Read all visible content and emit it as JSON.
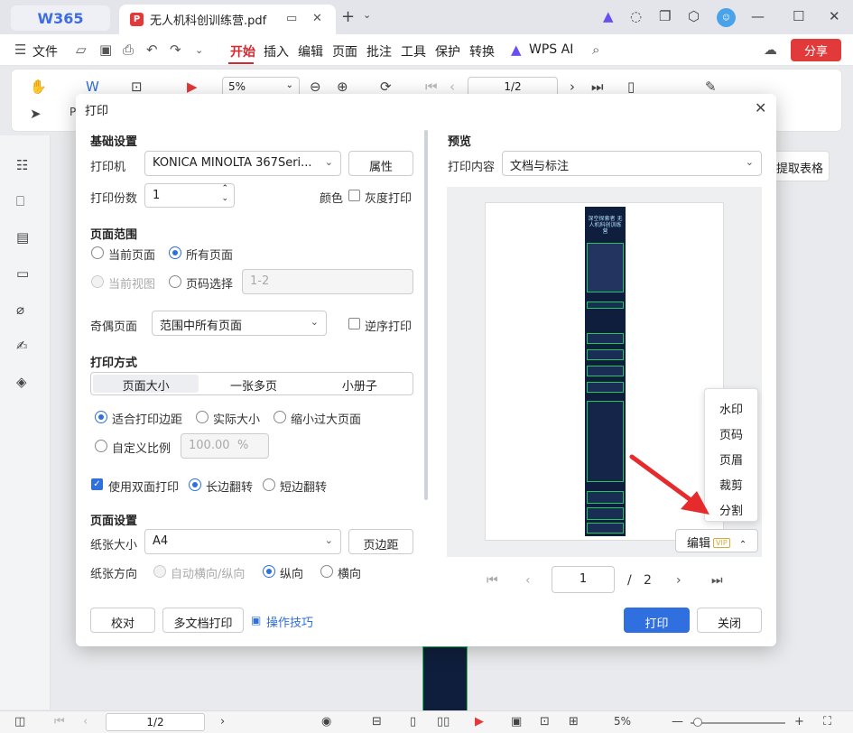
{
  "app": {
    "logo": "W365"
  },
  "tab": {
    "title": "无人机科创训练营.pdf"
  },
  "menu": {
    "file": "文件",
    "items": [
      "开始",
      "插入",
      "编辑",
      "页面",
      "批注",
      "工具",
      "保护",
      "转换"
    ],
    "wps_ai": "WPS AI",
    "share": "分享"
  },
  "toolbar": {
    "zoom": "5%",
    "page": "1/2",
    "pdf_label": "PI"
  },
  "sidebar_right": {
    "extract": "提取表格"
  },
  "statusbar": {
    "page": "1/2",
    "zoom": "5%"
  },
  "dialog": {
    "title": "打印",
    "basic": {
      "header": "基础设置",
      "printer_label": "打印机",
      "printer_value": "KONICA MINOLTA 367Seri...",
      "properties": "属性",
      "copies_label": "打印份数",
      "copies_value": "1",
      "color_label": "颜色",
      "grayscale": "灰度打印"
    },
    "range": {
      "header": "页面范围",
      "current_page": "当前页面",
      "all_pages": "所有页面",
      "current_view": "当前视图",
      "page_select": "页码选择",
      "page_select_value": "1-2",
      "odd_even_label": "奇偶页面",
      "odd_even_value": "范围中所有页面",
      "reverse": "逆序打印"
    },
    "mode": {
      "header": "打印方式",
      "tabs": [
        "页面大小",
        "一张多页",
        "小册子"
      ],
      "fit_margin": "适合打印边距",
      "actual_size": "实际大小",
      "shrink_large": "缩小过大页面",
      "custom_scale": "自定义比例",
      "scale_value": "100.00",
      "scale_unit": "%",
      "duplex": "使用双面打印",
      "long_edge": "长边翻转",
      "short_edge": "短边翻转"
    },
    "page_setup": {
      "header": "页面设置",
      "paper_size_label": "纸张大小",
      "paper_size_value": "A4",
      "margins": "页边距",
      "orientation_label": "纸张方向",
      "auto": "自动横向/纵向",
      "portrait": "纵向",
      "landscape": "横向"
    },
    "preview": {
      "header": "预览",
      "content_label": "打印内容",
      "content_value": "文档与标注",
      "image_title": "深空探索者 无人机科创训练营",
      "popup": [
        "水印",
        "页码",
        "页眉",
        "裁剪",
        "分割"
      ],
      "edit": "编辑",
      "vip": "VIP",
      "current_page": "1",
      "separator": "/",
      "total_pages": "2"
    },
    "footer": {
      "proof": "校对",
      "multi_print": "多文档打印",
      "tips": "操作技巧",
      "print": "打印",
      "close": "关闭"
    }
  }
}
